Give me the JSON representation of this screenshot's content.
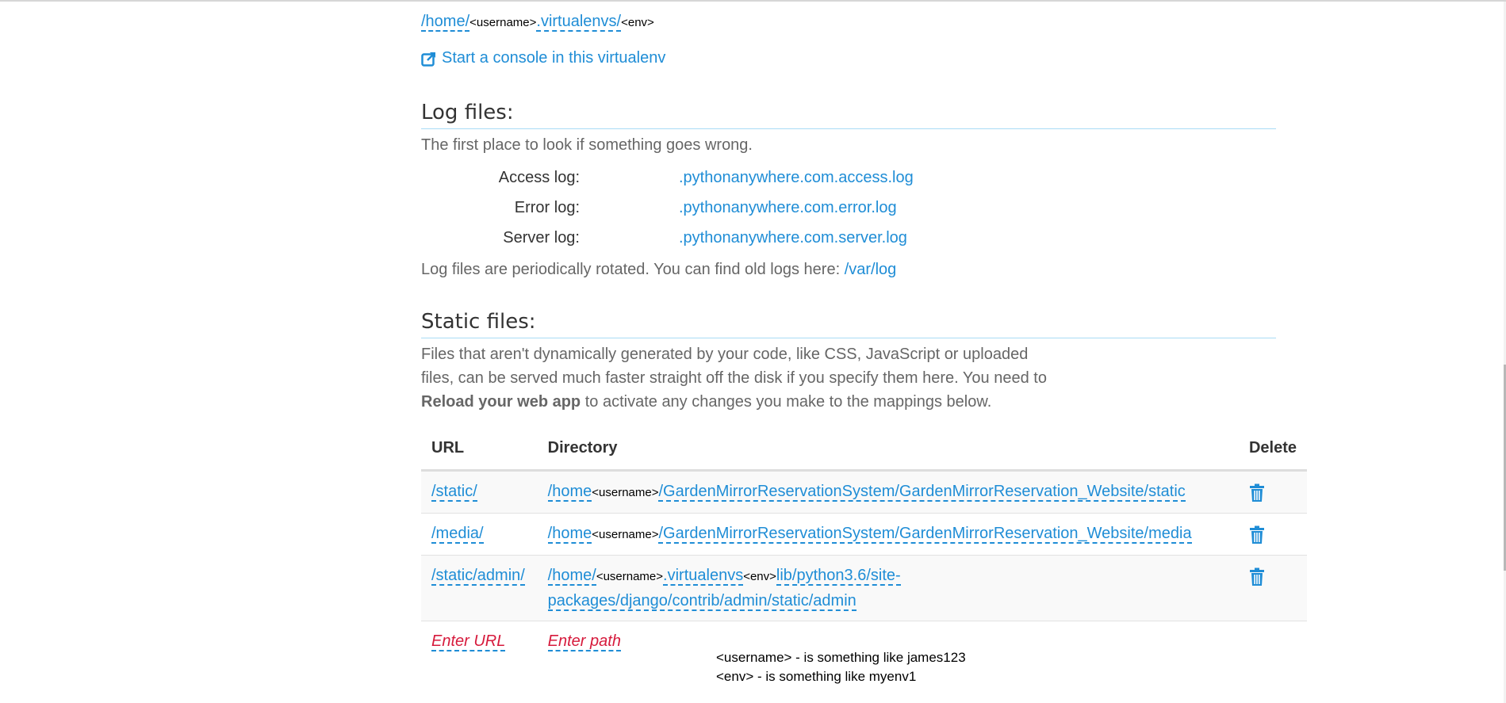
{
  "virtualenv": {
    "path_home": "/home/",
    "path_username": "<username>",
    "path_virtualenvs": ".virtualenvs/",
    "path_env": "<env>",
    "console_link": "Start a console in this virtualenv",
    "console_icon": "external-link-icon"
  },
  "log_files": {
    "title": "Log files:",
    "intro": "The first place to look if something goes wrong.",
    "rows": [
      {
        "label": "Access log:",
        "link": ".pythonanywhere.com.access.log"
      },
      {
        "label": "Error log:",
        "link": ".pythonanywhere.com.error.log"
      },
      {
        "label": "Server log:",
        "link": ".pythonanywhere.com.server.log"
      }
    ],
    "rotated_text": "Log files are periodically rotated. You can find old logs here:",
    "rotated_link": "/var/log"
  },
  "static_files": {
    "title": "Static files:",
    "para_line1": "Files that aren't dynamically generated by your code, like CSS, JavaScript or uploaded",
    "para_line2": "files, can be served much faster straight off the disk if you specify them here. You need to",
    "para_bold": "Reload your web app",
    "para_line3_rest": "to activate any changes you make to the mappings below.",
    "columns": {
      "url": "URL",
      "directory": "Directory",
      "delete": "Delete"
    },
    "rows": [
      {
        "url": "/static/",
        "dir_home": "/home",
        "dir_username": "<username>",
        "dir_rest": "/GardenMirrorReservationSystem/GardenMirrorReservation_Website/static"
      },
      {
        "url": "/media/",
        "dir_home": "/home",
        "dir_username": "<username>",
        "dir_rest": "/GardenMirrorReservationSystem/GardenMirrorReservation_Website/media"
      },
      {
        "url": "/static/admin/",
        "dir_home": "/home/",
        "dir_username": "<username>",
        "dir_virtualenvs": ".virtualenvs",
        "dir_env": "<env>",
        "dir_rest_line1": "lib/python3.6/site-",
        "dir_rest_line2": "packages/django/contrib/admin/static/admin"
      }
    ],
    "enter_url": "Enter URL",
    "enter_path": "Enter path",
    "delete_icon": "trash-icon",
    "accent_color": "#1f8dd6",
    "placeholder_color": "#d61a3c"
  },
  "annotation": {
    "line1": "<username> - is something like james123",
    "line2": "<env> - is something like myenv1"
  }
}
